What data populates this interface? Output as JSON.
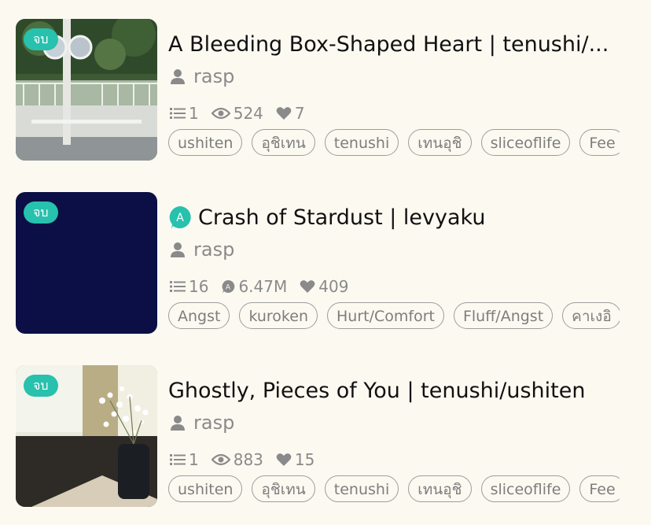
{
  "stories": [
    {
      "badge": "จบ",
      "title": "A Bleeding Box-Shaped Heart | tenushi/...",
      "has_ai_icon": false,
      "author": "rasp",
      "chapters": "1",
      "views_icon": "eye-icon",
      "views": "524",
      "likes": "7",
      "tags": [
        "ushiten",
        "อุชิเทน",
        "tenushi",
        "เทนอุชิ",
        "sliceoflife",
        "Fee"
      ]
    },
    {
      "badge": "จบ",
      "title": "Crash of Stardust | levyaku",
      "has_ai_icon": true,
      "ai_icon_letter": "A",
      "author": "rasp",
      "chapters": "16",
      "views_icon": "ai-views-icon",
      "views_icon_letter": "A",
      "views": "6.47M",
      "likes": "409",
      "cover_color": "#0b0f45",
      "tags": [
        "Angst",
        "kuroken",
        "Hurt/Comfort",
        "Fluff/Angst",
        "คาเงอิ"
      ]
    },
    {
      "badge": "จบ",
      "title": "Ghostly, Pieces of You | tenushi/ushiten",
      "has_ai_icon": false,
      "author": "rasp",
      "chapters": "1",
      "views_icon": "eye-icon",
      "views": "883",
      "likes": "15",
      "tags": [
        "ushiten",
        "อุชิเทน",
        "tenushi",
        "เทนอุชิ",
        "sliceoflife",
        "Fee"
      ]
    }
  ],
  "colors": {
    "background": "#fcf9f1",
    "badge": "#27c1ad",
    "meta_text": "#8a8a8a",
    "tag_border": "#9d9d9d"
  }
}
